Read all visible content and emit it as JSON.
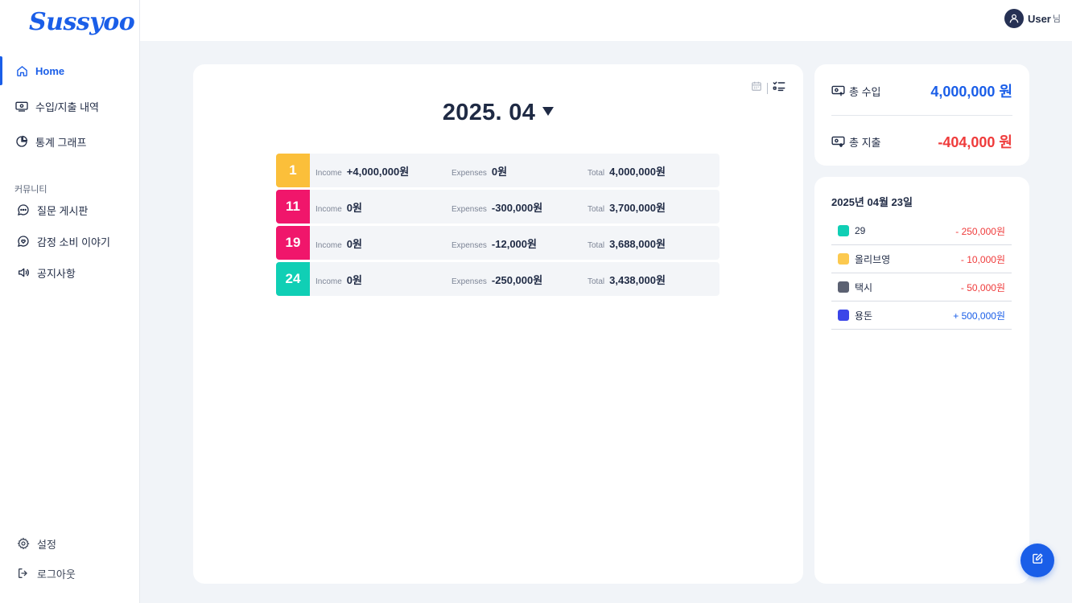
{
  "app": {
    "logo": "Sussyoo"
  },
  "sidebar": {
    "items": [
      {
        "label": "Home"
      },
      {
        "label": "수입/지출 내역"
      },
      {
        "label": "통계 그래프"
      }
    ],
    "community_label": "커뮤니티",
    "community_items": [
      {
        "label": "질문 게시판"
      },
      {
        "label": "감정 소비 이야기"
      },
      {
        "label": "공지사항"
      }
    ],
    "bottom_items": [
      {
        "label": "설정"
      },
      {
        "label": "로그아웃"
      }
    ]
  },
  "topbar": {
    "user_name": "User",
    "user_suffix": "님"
  },
  "main": {
    "month": "2025. 04",
    "labels": {
      "income": "Income",
      "expenses": "Expenses",
      "total": "Total"
    },
    "rows": [
      {
        "day": "1",
        "color": "#fbbf3a",
        "income": "+4,000,000원",
        "expenses": "0원",
        "total": "4,000,000원"
      },
      {
        "day": "11",
        "color": "#f0166b",
        "income": "0원",
        "expenses": "-300,000원",
        "total": "3,700,000원"
      },
      {
        "day": "19",
        "color": "#f0166b",
        "income": "0원",
        "expenses": "-12,000원",
        "total": "3,688,000원"
      },
      {
        "day": "24",
        "color": "#10cfb5",
        "income": "0원",
        "expenses": "-250,000원",
        "total": "3,438,000원"
      }
    ]
  },
  "summary": {
    "income_label": "총 수입",
    "income_value": "4,000,000 원",
    "income_color": "#1a5ee8",
    "expense_label": "총 지출",
    "expense_value": "-404,000 원",
    "expense_color": "#ef3b3b"
  },
  "detail": {
    "date": "2025년 04월 23일",
    "items": [
      {
        "name": "29",
        "color": "#10cfb5",
        "amount": "- 250,000원",
        "amount_color": "#ef3b3b"
      },
      {
        "name": "올리브영",
        "color": "#fcc94f",
        "amount": "- 10,000원",
        "amount_color": "#ef3b3b"
      },
      {
        "name": "택시",
        "color": "#5b6172",
        "amount": "- 50,000원",
        "amount_color": "#ef3b3b"
      },
      {
        "name": "용돈",
        "color": "#3b46e8",
        "amount": "+ 500,000원",
        "amount_color": "#1a5ee8"
      }
    ]
  }
}
